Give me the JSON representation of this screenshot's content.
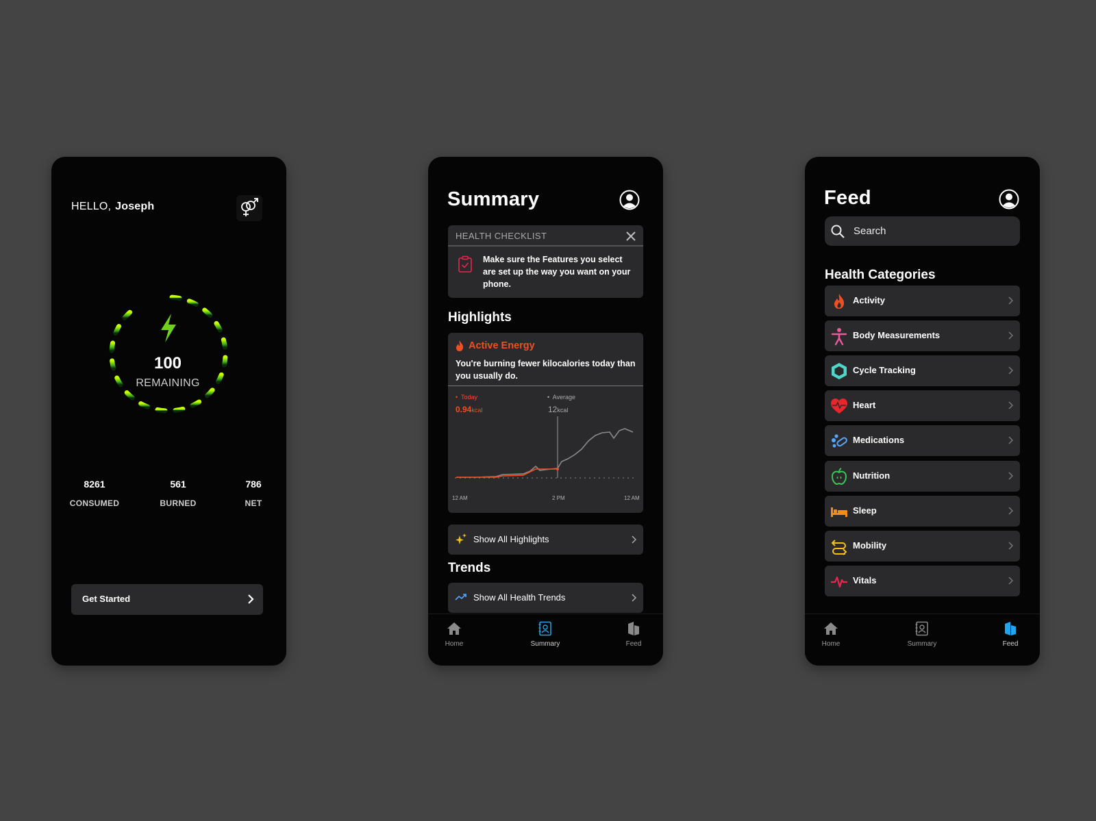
{
  "home": {
    "greeting": "HELLO,",
    "user_name": "Joseph",
    "ring": {
      "value": "100",
      "label": "REMAINING",
      "fill_fraction": 0.85
    },
    "stats": [
      {
        "value": "8261",
        "label": "CONSUMED"
      },
      {
        "value": "561",
        "label": "BURNED"
      },
      {
        "value": "786",
        "label": "NET"
      }
    ],
    "cta_label": "Get Started"
  },
  "summary": {
    "title": "Summary",
    "checklist": {
      "heading": "HEALTH CHECKLIST",
      "message": "Make sure the Features you select are set up the way you want on your phone."
    },
    "highlights_heading": "Highlights",
    "highlight": {
      "title": "Active Energy",
      "message": "You're burning fewer kilocalories today than you  usually do.",
      "today_label": "Today",
      "today_value": "0.94",
      "today_unit": "kcal",
      "avg_label": "Average",
      "avg_value": "12",
      "avg_unit": "kcal",
      "x_ticks": [
        "12 AM",
        "2 PM",
        "12 AM"
      ]
    },
    "show_highlights": "Show All Highlights",
    "trends_heading": "Trends",
    "show_trends": "Show All Health Trends"
  },
  "feed": {
    "title": "Feed",
    "search_placeholder": "Search",
    "categories_heading": "Health Categories",
    "categories": [
      {
        "label": "Activity",
        "icon": "flame-icon",
        "color": "#f04e23"
      },
      {
        "label": "Body Measurements",
        "icon": "person-icon",
        "color": "#e85a9b"
      },
      {
        "label": "Cycle Tracking",
        "icon": "hexagon-icon",
        "color": "#4fd6c8"
      },
      {
        "label": "Heart",
        "icon": "heart-icon",
        "color": "#e8262c"
      },
      {
        "label": "Medications",
        "icon": "pills-icon",
        "color": "#58a6ff"
      },
      {
        "label": "Nutrition",
        "icon": "apple-icon",
        "color": "#3fc35a"
      },
      {
        "label": "Sleep",
        "icon": "bed-icon",
        "color": "#f28c1a"
      },
      {
        "label": "Mobility",
        "icon": "arrows-icon",
        "color": "#f2c21a"
      },
      {
        "label": "Vitals",
        "icon": "pulse-icon",
        "color": "#e8264f"
      }
    ]
  },
  "tabs": [
    {
      "label": "Home",
      "icon": "home-icon"
    },
    {
      "label": "Summary",
      "icon": "summary-icon"
    },
    {
      "label": "Feed",
      "icon": "feed-icon"
    }
  ],
  "colors": {
    "accent_blue": "#1ea7f0",
    "energy_orange": "#f04e23",
    "ring_green": "#b8f000"
  }
}
